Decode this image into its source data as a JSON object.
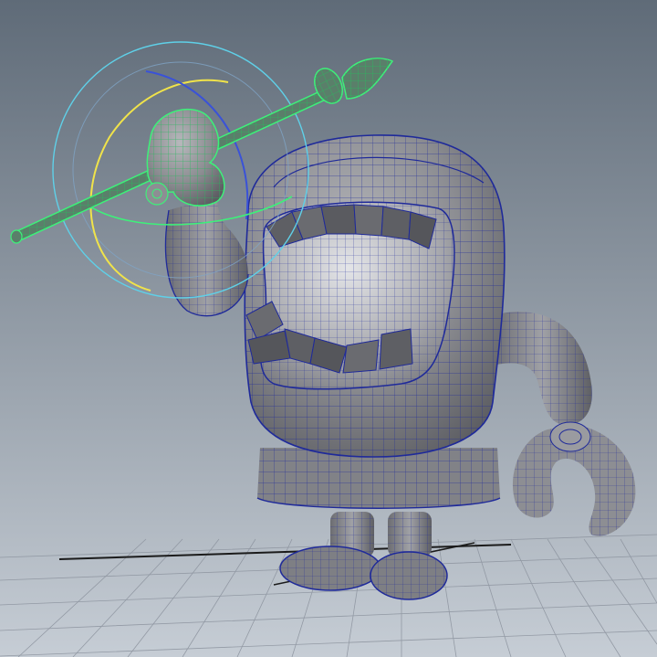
{
  "viewport": {
    "panel": "perspective-viewport",
    "background_top": "#5f6b78",
    "background_bottom": "#c6cdd5"
  },
  "scene": {
    "character": "cartoon-mouth-creature-wireframe-on-shaded",
    "mesh_color": "#7b7c80",
    "wire_color": "#1f2a9a",
    "selected_wire_color": "#3ef07a",
    "grid_color": "#8e95a0",
    "grid_axis_color": "#1b1b1b"
  },
  "manipulator": {
    "type": "rotate-tool",
    "ring_colors": {
      "outer": "#5fd0e8",
      "x": "#e23b3b",
      "y": "#f0e34a",
      "z": "#3a52d8",
      "free": "#3ef07a"
    }
  }
}
